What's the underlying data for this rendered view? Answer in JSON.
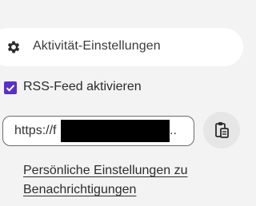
{
  "activity_settings": {
    "label": "Aktivität-Einstellungen",
    "icon": "gear-icon"
  },
  "rss": {
    "checkbox_label": "RSS-Feed aktivieren",
    "checked": true,
    "accent_color": "#5b2fc9"
  },
  "feed_url": {
    "visible_prefix": "https://f",
    "ellipsis": "..",
    "copy_icon": "clipboard-icon"
  },
  "notification_link": {
    "line1": "Persönliche Einstellungen zu",
    "line2": "Benachrichtigungen"
  }
}
